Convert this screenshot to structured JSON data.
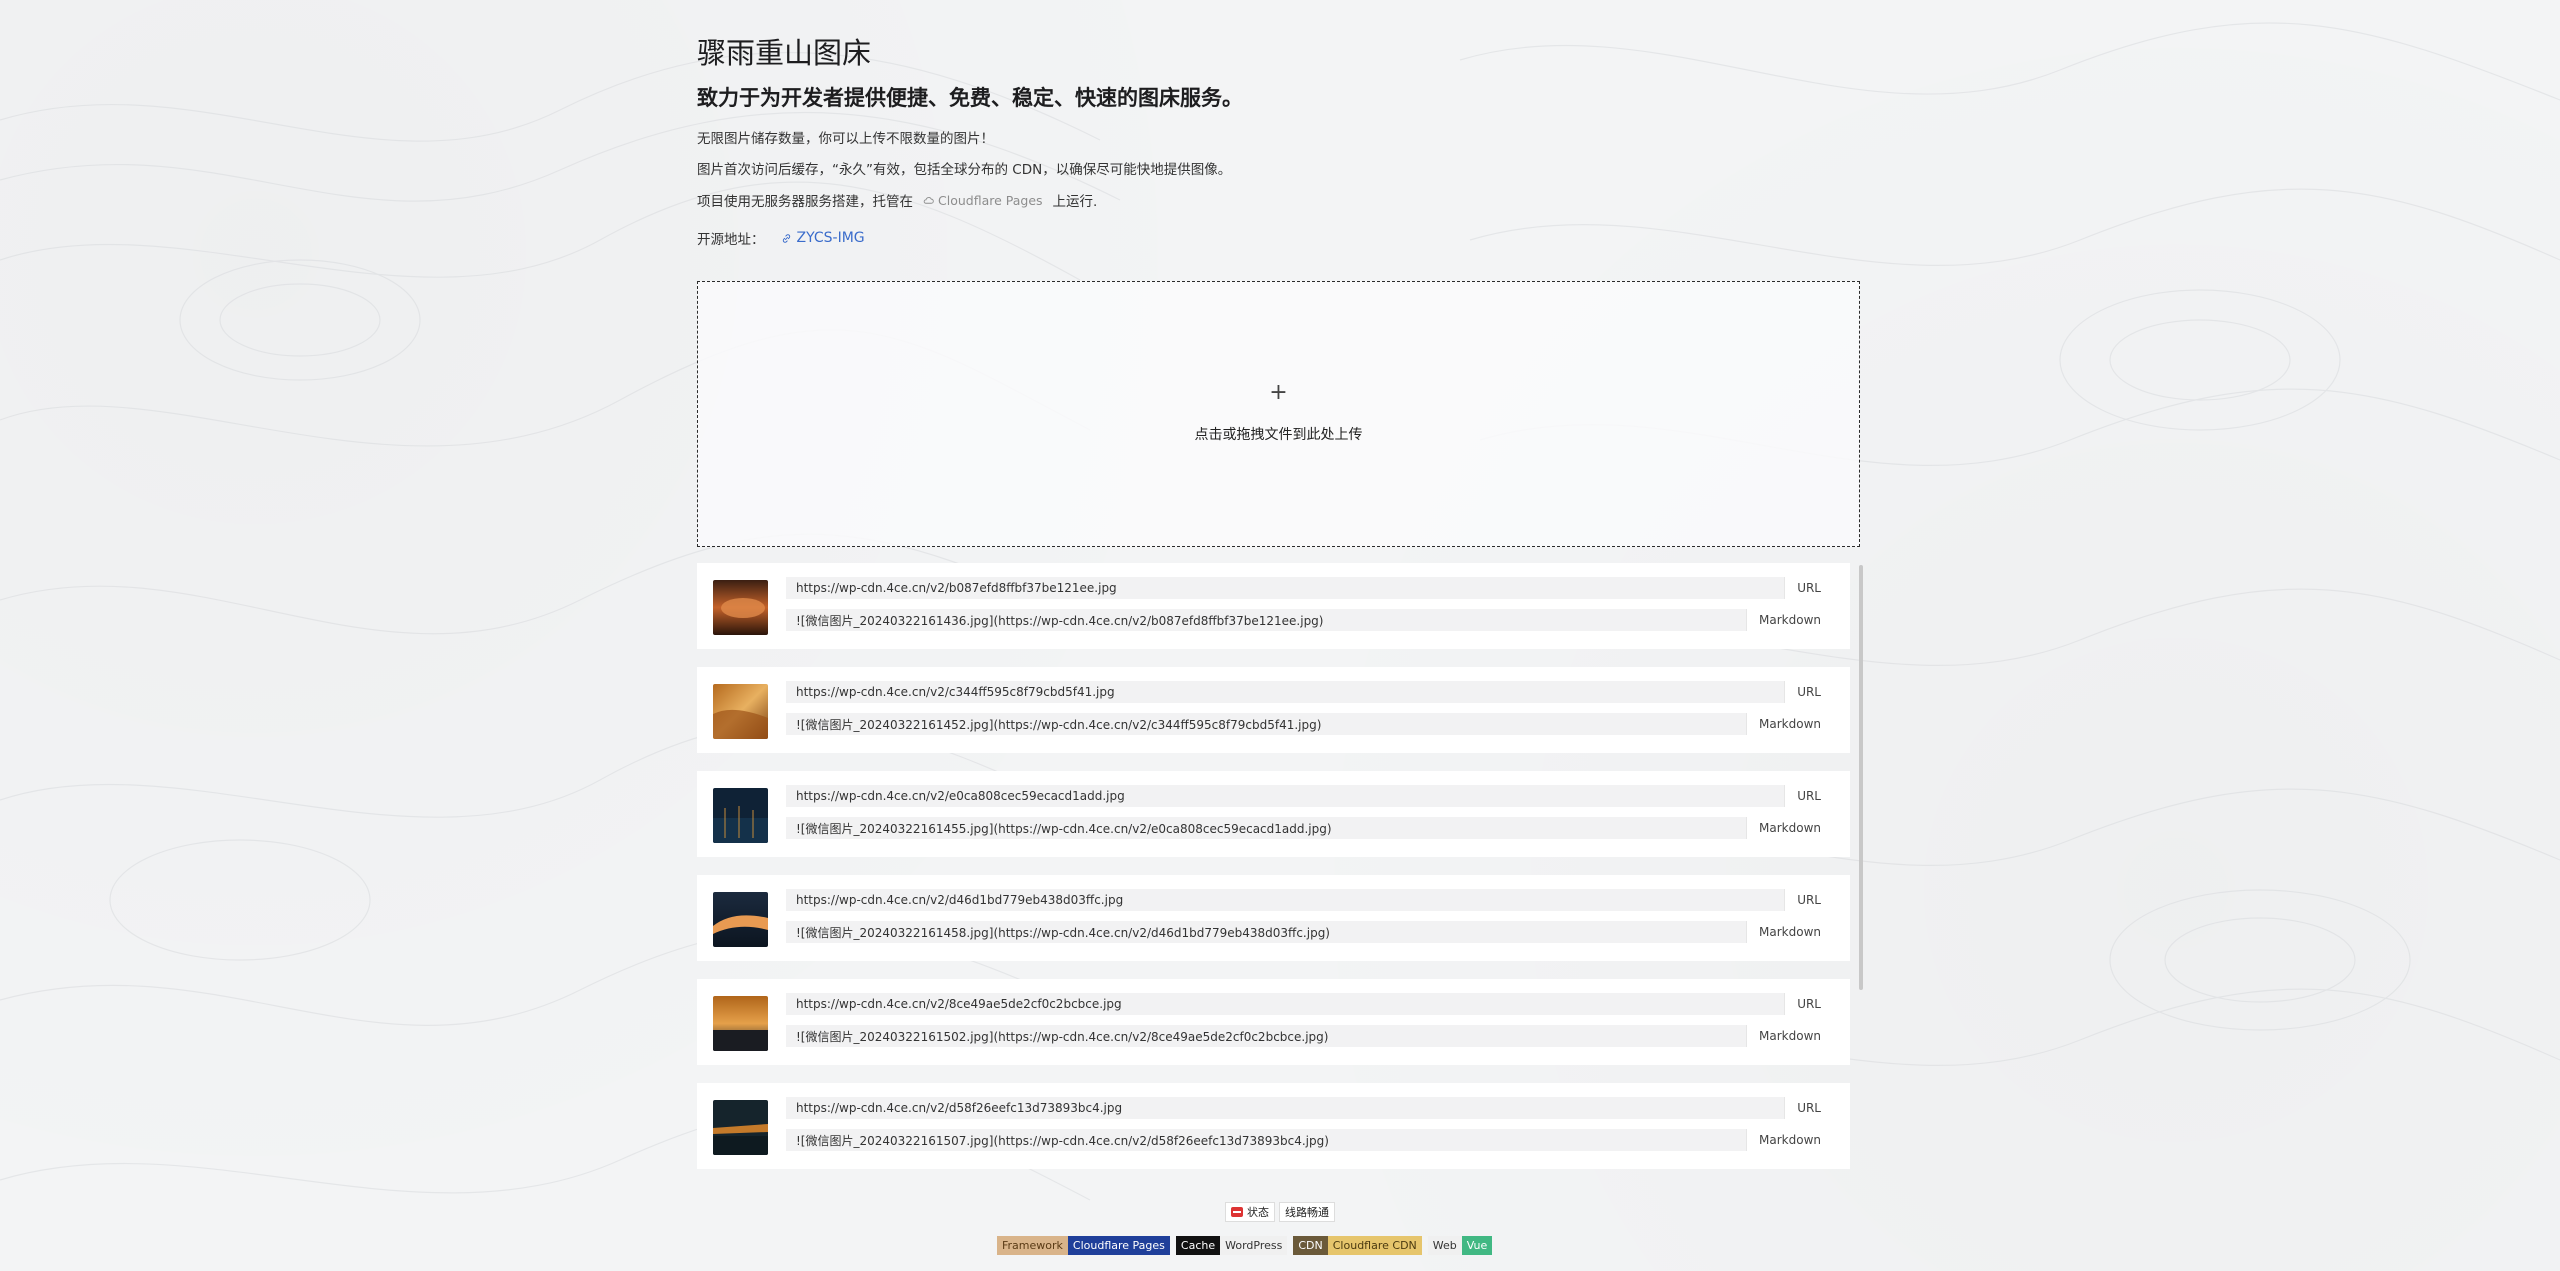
{
  "header": {
    "title": "骤雨重山图床",
    "subtitle": "致力于为开发者提供便捷、免费、稳定、快速的图床服务。",
    "line1": "无限图片储存数量，你可以上传不限数量的图片！",
    "line2": "图片首次访问后缓存，“永久”有效，包括全球分布的 CDN，以确保尽可能快地提供图像。",
    "line3_prefix": "项目使用无服务器服务搭建，托管在",
    "line3_tag": "Cloudflare Pages",
    "line3_suffix": "上运行.",
    "source_label": "开源地址：",
    "source_link": "ZYCS-IMG"
  },
  "upload": {
    "plus": "+",
    "hint": "点击或拖拽文件到此处上传"
  },
  "items": [
    {
      "url": "https://wp-cdn.4ce.cn/v2/b087efd8ffbf37be121ee.jpg",
      "markdown": "![微信图片_20240322161436.jpg](https://wp-cdn.4ce.cn/v2/b087efd8ffbf37be121ee.jpg)",
      "url_btn": "URL",
      "md_btn": "Markdown"
    },
    {
      "url": "https://wp-cdn.4ce.cn/v2/c344ff595c8f79cbd5f41.jpg",
      "markdown": "![微信图片_20240322161452.jpg](https://wp-cdn.4ce.cn/v2/c344ff595c8f79cbd5f41.jpg)",
      "url_btn": "URL",
      "md_btn": "Markdown"
    },
    {
      "url": "https://wp-cdn.4ce.cn/v2/e0ca808cec59ecacd1add.jpg",
      "markdown": "![微信图片_20240322161455.jpg](https://wp-cdn.4ce.cn/v2/e0ca808cec59ecacd1add.jpg)",
      "url_btn": "URL",
      "md_btn": "Markdown"
    },
    {
      "url": "https://wp-cdn.4ce.cn/v2/d46d1bd779eb438d03ffc.jpg",
      "markdown": "![微信图片_20240322161458.jpg](https://wp-cdn.4ce.cn/v2/d46d1bd779eb438d03ffc.jpg)",
      "url_btn": "URL",
      "md_btn": "Markdown"
    },
    {
      "url": "https://wp-cdn.4ce.cn/v2/8ce49ae5de2cf0c2bcbce.jpg",
      "markdown": "![微信图片_20240322161502.jpg](https://wp-cdn.4ce.cn/v2/8ce49ae5de2cf0c2bcbce.jpg)",
      "url_btn": "URL",
      "md_btn": "Markdown"
    },
    {
      "url": "https://wp-cdn.4ce.cn/v2/d58f26eefc13d73893bc4.jpg",
      "markdown": "![微信图片_20240322161507.jpg](https://wp-cdn.4ce.cn/v2/d58f26eefc13d73893bc4.jpg)",
      "url_btn": "URL",
      "md_btn": "Markdown"
    }
  ],
  "footer": {
    "status_label": "状态",
    "status_value": "线路畅通",
    "badges": [
      {
        "left": "Framework",
        "right": "Cloudflare Pages"
      },
      {
        "left": "Cache",
        "right": "WordPress"
      },
      {
        "left": "CDN",
        "right": "Cloudflare CDN"
      },
      {
        "left": "Web",
        "right": "Vue"
      }
    ]
  }
}
